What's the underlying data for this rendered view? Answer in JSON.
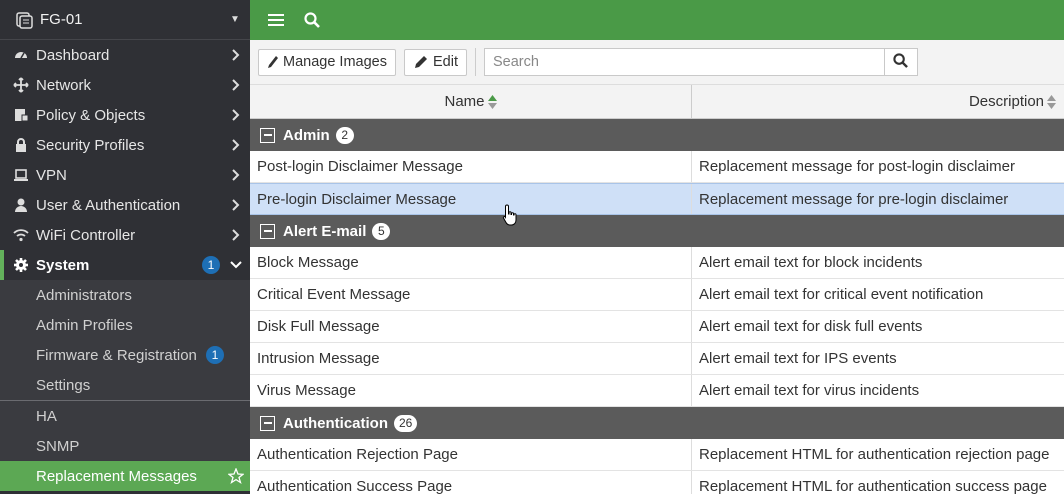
{
  "device": {
    "name": "FG-01"
  },
  "nav": [
    {
      "label": "Dashboard",
      "icon": "dashboard-icon"
    },
    {
      "label": "Network",
      "icon": "network-icon"
    },
    {
      "label": "Policy & Objects",
      "icon": "policy-icon"
    },
    {
      "label": "Security Profiles",
      "icon": "lock-icon"
    },
    {
      "label": "VPN",
      "icon": "laptop-icon"
    },
    {
      "label": "User & Authentication",
      "icon": "user-icon"
    },
    {
      "label": "WiFi Controller",
      "icon": "wifi-icon"
    },
    {
      "label": "System",
      "icon": "gear-icon",
      "badge": "1"
    }
  ],
  "system_sub": [
    {
      "label": "Administrators"
    },
    {
      "label": "Admin Profiles"
    },
    {
      "label": "Firmware & Registration",
      "badge": "1"
    },
    {
      "label": "Settings"
    },
    {
      "label": "HA"
    },
    {
      "label": "SNMP"
    },
    {
      "label": "Replacement Messages"
    }
  ],
  "toolbar": {
    "manage_images_label": "Manage Images",
    "edit_label": "Edit",
    "search_placeholder": "Search"
  },
  "table": {
    "columns": [
      "Name",
      "Description"
    ],
    "groups": [
      {
        "title": "Admin",
        "count": "2",
        "rows": [
          {
            "name": "Post-login Disclaimer Message",
            "desc": "Replacement message for post-login disclaimer"
          },
          {
            "name": "Pre-login Disclaimer Message",
            "desc": "Replacement message for pre-login disclaimer"
          }
        ]
      },
      {
        "title": "Alert E-mail",
        "count": "5",
        "rows": [
          {
            "name": "Block Message",
            "desc": "Alert email text for block incidents"
          },
          {
            "name": "Critical Event Message",
            "desc": "Alert email text for critical event notification"
          },
          {
            "name": "Disk Full Message",
            "desc": "Alert email text for disk full events"
          },
          {
            "name": "Intrusion Message",
            "desc": "Alert email text for IPS events"
          },
          {
            "name": "Virus Message",
            "desc": "Alert email text for virus incidents"
          }
        ]
      },
      {
        "title": "Authentication",
        "count": "26",
        "rows": [
          {
            "name": "Authentication Rejection Page",
            "desc": "Replacement HTML for authentication rejection page"
          },
          {
            "name": "Authentication Success Page",
            "desc": "Replacement HTML for authentication success page"
          }
        ]
      }
    ]
  },
  "colors": {
    "topbar": "#4a9a47",
    "sidebar": "#2f3035",
    "selected_menu": "#5ca854",
    "selected_row": "#cfe0f7",
    "badge": "#1e6fb5"
  }
}
